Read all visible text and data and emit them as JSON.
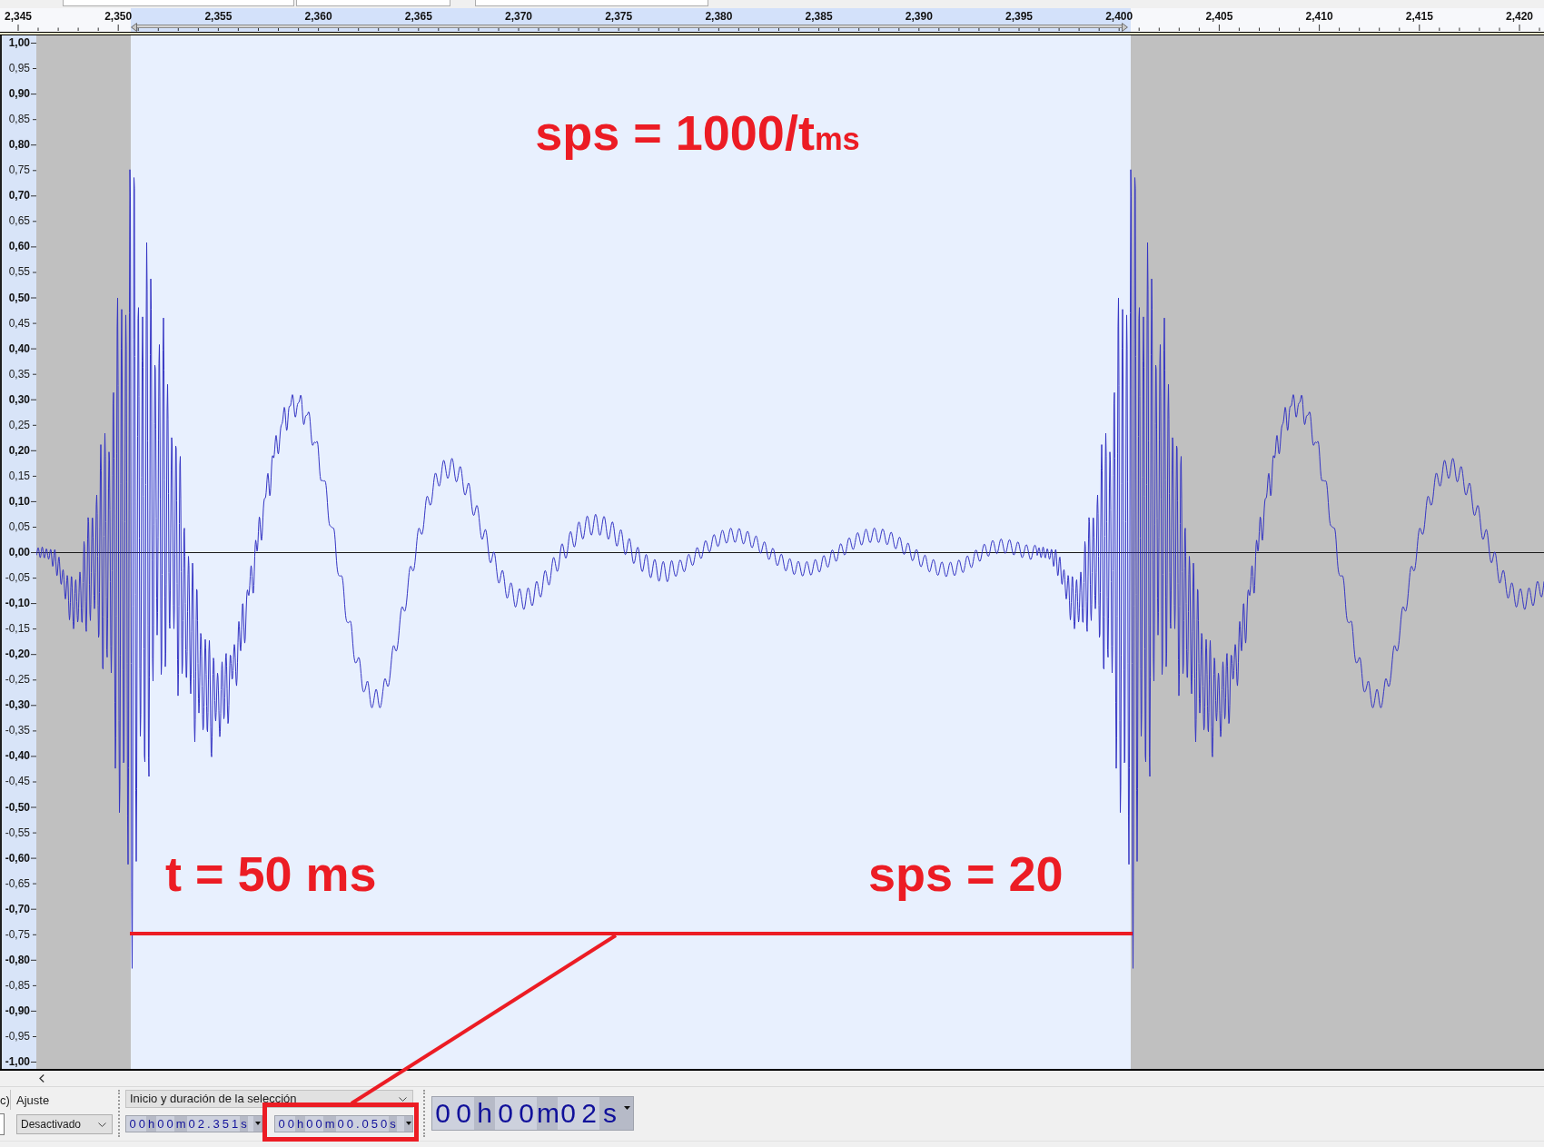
{
  "ruler": {
    "labels": [
      "2,345",
      "2,350",
      "2,355",
      "2,360",
      "2,365",
      "2,370",
      "2,375",
      "2,380",
      "2,385",
      "2,390",
      "2,395",
      "2,400",
      "2,405",
      "2,410",
      "2,415",
      "2,420"
    ]
  },
  "amplitude_scale": {
    "labels": [
      {
        "text": "1,00",
        "major": true
      },
      {
        "text": "0,95",
        "major": false
      },
      {
        "text": "0,90",
        "major": true
      },
      {
        "text": "0,85",
        "major": false
      },
      {
        "text": "0,80",
        "major": true
      },
      {
        "text": "0,75",
        "major": false
      },
      {
        "text": "0,70",
        "major": true
      },
      {
        "text": "0,65",
        "major": false
      },
      {
        "text": "0,60",
        "major": true
      },
      {
        "text": "0,55",
        "major": false
      },
      {
        "text": "0,50",
        "major": true
      },
      {
        "text": "0,45",
        "major": false
      },
      {
        "text": "0,40",
        "major": true
      },
      {
        "text": "0,35",
        "major": false
      },
      {
        "text": "0,30",
        "major": true
      },
      {
        "text": "0,25",
        "major": false
      },
      {
        "text": "0,20",
        "major": true
      },
      {
        "text": "0,15",
        "major": false
      },
      {
        "text": "0,10",
        "major": true
      },
      {
        "text": "0,05",
        "major": false
      },
      {
        "text": "0,00",
        "major": true
      },
      {
        "text": "-0,05",
        "major": false
      },
      {
        "text": "-0,10",
        "major": true
      },
      {
        "text": "-0,15",
        "major": false
      },
      {
        "text": "-0,20",
        "major": true
      },
      {
        "text": "-0,25",
        "major": false
      },
      {
        "text": "-0,30",
        "major": true
      },
      {
        "text": "-0,35",
        "major": false
      },
      {
        "text": "-0,40",
        "major": true
      },
      {
        "text": "-0,45",
        "major": false
      },
      {
        "text": "-0,50",
        "major": true
      },
      {
        "text": "-0,55",
        "major": false
      },
      {
        "text": "-0,60",
        "major": true
      },
      {
        "text": "-0,65",
        "major": false
      },
      {
        "text": "-0,70",
        "major": true
      },
      {
        "text": "-0,75",
        "major": false
      },
      {
        "text": "-0,80",
        "major": true
      },
      {
        "text": "-0,85",
        "major": false
      },
      {
        "text": "-0,90",
        "major": true
      },
      {
        "text": "-0,95",
        "major": false
      },
      {
        "text": "-1,00",
        "major": true
      }
    ]
  },
  "annotations": {
    "formula": "sps = 1000/t$_{ms}$",
    "duration": "t = 50 ms",
    "rate": "sps = 20"
  },
  "toolbar": {
    "partial_label": "c)",
    "snap": {
      "label": "Ajuste",
      "value": "Desactivado"
    },
    "selection": {
      "mode": "Inicio y duración de la selección",
      "start": "00h00m02.351s",
      "duration": "00h00m00.050s"
    },
    "time_display": "00h00m02s"
  }
}
